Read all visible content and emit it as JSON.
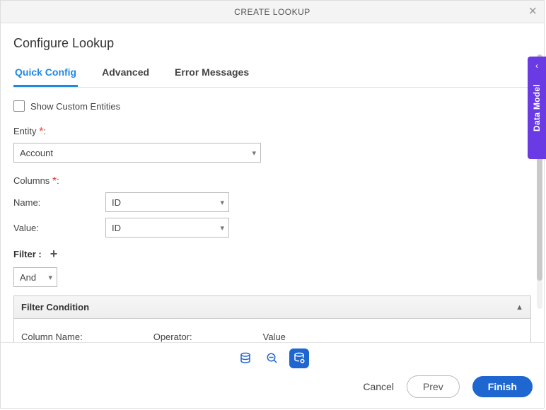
{
  "titlebar": {
    "title": "CREATE LOOKUP"
  },
  "heading": "Configure Lookup",
  "tabs": {
    "quick": "Quick Config",
    "advanced": "Advanced",
    "errors": "Error Messages"
  },
  "show_custom": "Show Custom Entities",
  "entity": {
    "label": "Entity",
    "value": "Account"
  },
  "columns": {
    "label": "Columns",
    "name_label": "Name:",
    "name_value": "ID",
    "value_label": "Value:",
    "value_value": "ID"
  },
  "filter": {
    "label": "Filter :",
    "logic": "And",
    "panel_title": "Filter Condition",
    "col_name": "Column Name:",
    "operator": "Operator:",
    "value": "Value"
  },
  "sidetab": "Data Model",
  "footer": {
    "cancel": "Cancel",
    "prev": "Prev",
    "finish": "Finish"
  }
}
